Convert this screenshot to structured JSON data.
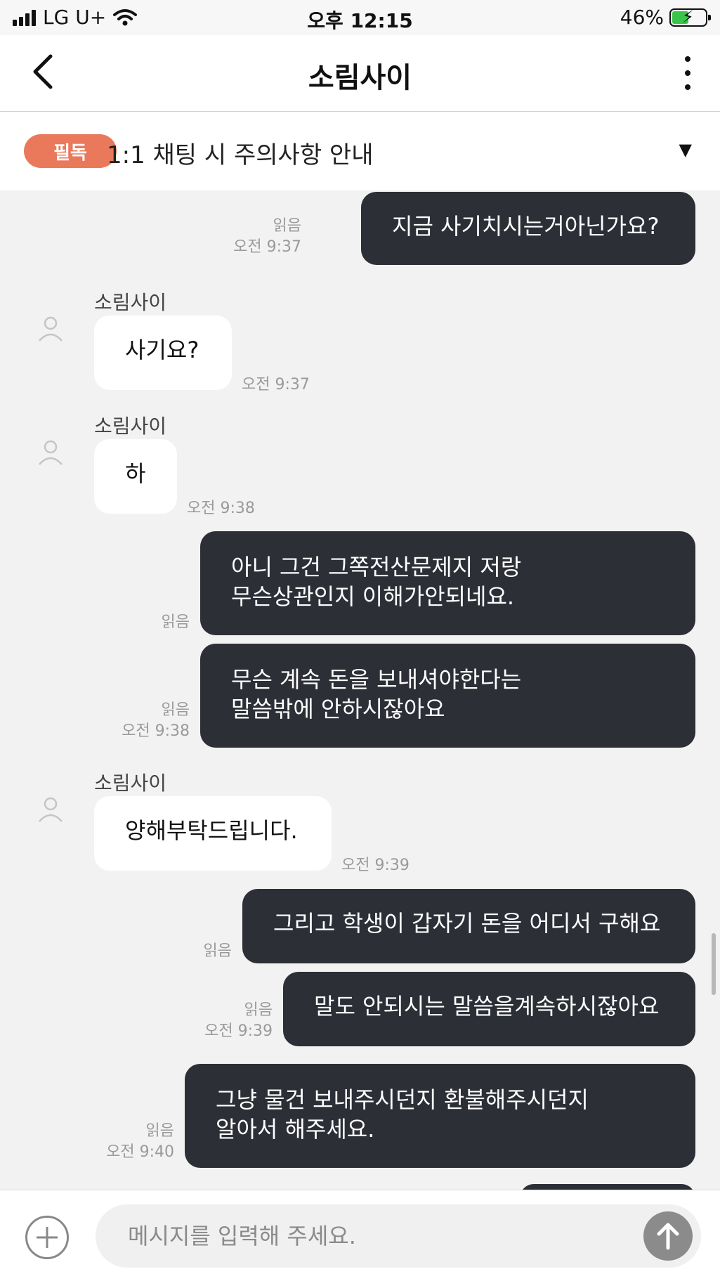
{
  "status_bar": {
    "carrier": "LG U+",
    "time": "오후 12:15",
    "battery": "46%",
    "battery_level": 0.46
  },
  "header": {
    "title": "소림사이"
  },
  "notice": {
    "badge": "필독",
    "text": "1:1 채팅 시 주의사항 안내",
    "toggle": "▼"
  },
  "messages": [
    {
      "direction": "out",
      "lines": [
        "지금 사기치시는거아닌가요?"
      ],
      "read": "읽음",
      "time": "오전 9:37"
    },
    {
      "direction": "in",
      "sender": "소림사이",
      "lines": [
        "사기요?"
      ],
      "time": "오전 9:37"
    },
    {
      "direction": "in",
      "sender": "소림사이",
      "lines": [
        "하"
      ],
      "time": "오전 9:38"
    },
    {
      "direction": "out",
      "lines": [
        "아니 그건 그쪽전산문제지 저랑",
        "무슨상관인지 이해가안되네요."
      ],
      "read": "읽음"
    },
    {
      "direction": "out",
      "lines": [
        "무슨 계속 돈을 보내셔야한다는",
        "말씀밖에 안하시잖아요"
      ],
      "read": "읽음",
      "time": "오전 9:38"
    },
    {
      "direction": "in",
      "sender": "소림사이",
      "lines": [
        "양해부탁드립니다."
      ],
      "time": "오전 9:39"
    },
    {
      "direction": "out",
      "lines": [
        "그리고 학생이 갑자기 돈을 어디서 구해요"
      ],
      "read": "읽음"
    },
    {
      "direction": "out",
      "lines": [
        "말도 안되시는 말씀을계속하시잖아요"
      ],
      "read": "읽음",
      "time": "오전 9:39"
    },
    {
      "direction": "out",
      "lines": [
        "그냥 물건 보내주시던지 환불해주시던지",
        "알아서 해주세요."
      ],
      "read": "읽음",
      "time": "오전 9:40"
    }
  ],
  "input": {
    "placeholder": "메시지를 입력해 주세요."
  },
  "icons": {
    "back": "chevron-left-icon",
    "more": "more-vertical-icon",
    "add": "plus-circle-icon",
    "send": "arrow-up-icon",
    "avatar": "user-icon"
  },
  "colors": {
    "badge": "#e9795a",
    "outgoing_bubble": "#2d2f37",
    "incoming_bubble": "#ffffff",
    "chat_background": "#f2f2f2"
  }
}
